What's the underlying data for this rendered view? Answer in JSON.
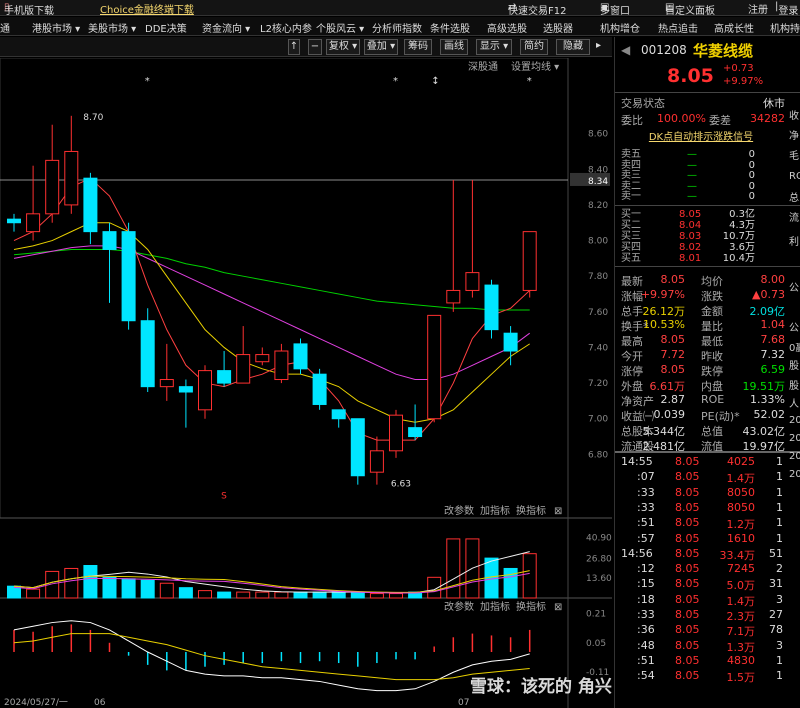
{
  "topbar": {
    "download": "手机版下载",
    "choice": "Choice金融终端下载",
    "quick_trade": "快速交易F12",
    "multi_window": "多窗口",
    "custom_panel": "自定义面板",
    "register": "注册",
    "login": "登录"
  },
  "menubar": {
    "items": [
      "通",
      "港股市场 ▾",
      "美股市场 ▾",
      "DDE决策",
      "资金流向 ▾",
      "L2核心内参",
      "个股风云 ▾",
      "分析师指数",
      "条件选股",
      "高级选股",
      "选股器",
      "机构增仓",
      "热点追击",
      "高成长性",
      "机构持"
    ]
  },
  "toolbar": {
    "items": [
      "↑",
      "−",
      "复权 ▾",
      "叠加 ▾",
      "筹码",
      "画线",
      "显示 ▾",
      "简约",
      "隐藏"
    ]
  },
  "chart": {
    "top_labels": [
      "深股通",
      "设置均线 ▾"
    ],
    "mid_labels": [
      "改参数",
      "加指标",
      "换指标"
    ],
    "bot_labels": [
      "改参数",
      "加指标",
      "换指标"
    ],
    "x_labels": [
      "2024/05/27/一",
      "06",
      "07"
    ],
    "high_label": "8.70",
    "low_label": "6.63",
    "price_line_label": "8.34",
    "vol_axis": [
      "40.90",
      "26.80",
      "13.60"
    ],
    "macd_axis": [
      "0.21",
      "0.05",
      "-0.11"
    ],
    "watermark": "雪球：该死的 角兴系-游资"
  },
  "chart_data": {
    "type": "candlestick",
    "price_ylim": [
      6.6,
      8.8
    ],
    "price_ticks": [
      "8.60",
      "8.40",
      "8.20",
      "8.00",
      "7.80",
      "7.60",
      "7.40",
      "7.20",
      "7.00",
      "6.80"
    ],
    "candles": [
      {
        "o": 8.12,
        "c": 8.1,
        "h": 8.15,
        "l": 8.05,
        "up": false
      },
      {
        "o": 8.05,
        "c": 8.15,
        "h": 8.42,
        "l": 8.0,
        "up": true
      },
      {
        "o": 8.15,
        "c": 8.45,
        "h": 8.65,
        "l": 8.1,
        "up": true
      },
      {
        "o": 8.2,
        "c": 8.5,
        "h": 8.7,
        "l": 8.15,
        "up": true
      },
      {
        "o": 8.35,
        "c": 8.05,
        "h": 8.38,
        "l": 7.98,
        "up": false
      },
      {
        "o": 8.05,
        "c": 7.95,
        "h": 8.1,
        "l": 7.65,
        "up": false
      },
      {
        "o": 8.05,
        "c": 7.55,
        "h": 8.1,
        "l": 7.5,
        "up": false
      },
      {
        "o": 7.55,
        "c": 7.18,
        "h": 7.62,
        "l": 7.15,
        "up": false
      },
      {
        "o": 7.18,
        "c": 7.22,
        "h": 7.42,
        "l": 7.1,
        "up": true
      },
      {
        "o": 7.18,
        "c": 7.15,
        "h": 7.22,
        "l": 6.95,
        "up": false
      },
      {
        "o": 7.05,
        "c": 7.27,
        "h": 7.3,
        "l": 7.0,
        "up": true
      },
      {
        "o": 7.27,
        "c": 7.2,
        "h": 7.38,
        "l": 7.18,
        "up": false
      },
      {
        "o": 7.2,
        "c": 7.36,
        "h": 7.52,
        "l": 7.2,
        "up": true
      },
      {
        "o": 7.32,
        "c": 7.36,
        "h": 7.4,
        "l": 7.3,
        "up": true
      },
      {
        "o": 7.22,
        "c": 7.38,
        "h": 7.42,
        "l": 7.2,
        "up": true
      },
      {
        "o": 7.42,
        "c": 7.28,
        "h": 7.45,
        "l": 7.25,
        "up": false
      },
      {
        "o": 7.25,
        "c": 7.08,
        "h": 7.28,
        "l": 7.05,
        "up": false
      },
      {
        "o": 7.05,
        "c": 7.0,
        "h": 7.05,
        "l": 6.95,
        "up": false
      },
      {
        "o": 7.0,
        "c": 6.68,
        "h": 7.0,
        "l": 6.63,
        "up": false
      },
      {
        "o": 6.7,
        "c": 6.82,
        "h": 6.9,
        "l": 6.63,
        "up": true
      },
      {
        "o": 6.82,
        "c": 7.02,
        "h": 7.05,
        "l": 6.78,
        "up": true
      },
      {
        "o": 6.95,
        "c": 6.9,
        "h": 7.08,
        "l": 6.88,
        "up": false
      },
      {
        "o": 7.0,
        "c": 7.58,
        "h": 7.58,
        "l": 6.98,
        "up": true
      },
      {
        "o": 7.65,
        "c": 7.72,
        "h": 8.34,
        "l": 7.6,
        "up": true
      },
      {
        "o": 7.72,
        "c": 7.82,
        "h": 8.34,
        "l": 7.68,
        "up": true
      },
      {
        "o": 7.75,
        "c": 7.5,
        "h": 7.78,
        "l": 7.45,
        "up": false
      },
      {
        "o": 7.38,
        "c": 7.48,
        "h": 7.52,
        "l": 7.3,
        "up": false
      },
      {
        "o": 7.72,
        "c": 8.05,
        "h": 8.05,
        "l": 7.68,
        "up": true
      }
    ],
    "ma5": [
      8.0,
      8.05,
      8.15,
      8.3,
      8.35,
      8.25,
      8.05,
      7.75,
      7.5,
      7.3,
      7.2,
      7.18,
      7.22,
      7.25,
      7.3,
      7.32,
      7.22,
      7.1,
      6.92,
      6.88,
      6.88,
      6.88,
      7.0,
      7.2,
      7.45,
      7.58,
      7.62,
      7.72
    ],
    "ma10": [
      7.95,
      7.97,
      8.0,
      8.05,
      8.1,
      8.1,
      8.05,
      7.95,
      7.8,
      7.65,
      7.5,
      7.4,
      7.32,
      7.28,
      7.25,
      7.25,
      7.22,
      7.18,
      7.1,
      7.05,
      7.0,
      6.98,
      7.0,
      7.05,
      7.15,
      7.25,
      7.35,
      7.42
    ],
    "ma20": [
      7.9,
      7.92,
      7.94,
      7.96,
      7.97,
      7.97,
      7.95,
      7.9,
      7.85,
      7.8,
      7.75,
      7.7,
      7.65,
      7.6,
      7.55,
      7.5,
      7.45,
      7.4,
      7.35,
      7.3,
      7.25,
      7.22,
      7.22,
      7.25,
      7.3,
      7.35,
      7.4,
      7.48
    ],
    "ma30": [
      7.92,
      7.93,
      7.94,
      7.95,
      7.95,
      7.95,
      7.94,
      7.92,
      7.9,
      7.87,
      7.85,
      7.82,
      7.8,
      7.78,
      7.76,
      7.74,
      7.72,
      7.7,
      7.68,
      7.66,
      7.65,
      7.64,
      7.63,
      7.62,
      7.62,
      7.61,
      7.61,
      7.61
    ],
    "volume": [
      8,
      6,
      18,
      20,
      22,
      14,
      13,
      12,
      10,
      7,
      5,
      4,
      4,
      4,
      4,
      4,
      4,
      4,
      4,
      3,
      3,
      4,
      14,
      40,
      40,
      27,
      20,
      30
    ],
    "vol_ylim": [
      0,
      44
    ],
    "macd": [
      0.12,
      0.11,
      0.14,
      0.15,
      0.12,
      0.05,
      -0.02,
      -0.07,
      -0.1,
      -0.1,
      -0.08,
      -0.07,
      -0.06,
      -0.06,
      -0.05,
      -0.06,
      -0.05,
      -0.06,
      -0.08,
      -0.06,
      -0.04,
      -0.04,
      0.03,
      0.08,
      0.1,
      0.09,
      0.08,
      0.12
    ],
    "dif": [
      0.12,
      0.14,
      0.16,
      0.17,
      0.16,
      0.12,
      0.06,
      0.0,
      -0.05,
      -0.1,
      -0.12,
      -0.13,
      -0.13,
      -0.14,
      -0.14,
      -0.15,
      -0.16,
      -0.18,
      -0.2,
      -0.21,
      -0.21,
      -0.2,
      -0.16,
      -0.11,
      -0.07,
      -0.05,
      -0.04,
      -0.01
    ],
    "dea": [
      0.05,
      0.06,
      0.08,
      0.1,
      0.1,
      0.1,
      0.08,
      0.06,
      0.04,
      0.01,
      -0.02,
      -0.04,
      -0.06,
      -0.08,
      -0.09,
      -0.1,
      -0.11,
      -0.12,
      -0.13,
      -0.14,
      -0.15,
      -0.15,
      -0.15,
      -0.14,
      -0.12,
      -0.11,
      -0.1,
      -0.09
    ],
    "macd_ylim": [
      -0.25,
      0.25
    ]
  },
  "panel": {
    "code": "001208",
    "name": "华菱线缆",
    "price": "8.05",
    "change": "+0.73",
    "change_pct": "+9.97%",
    "status_label": "交易状态",
    "status": "休市",
    "wb_label": "委比",
    "wb": "100.00%",
    "wc_label": "委差",
    "wc": "34282",
    "dk_signal": "DK点自动排示涨跌信号",
    "asks": [
      {
        "l": "卖五",
        "p": "—",
        "v": "0"
      },
      {
        "l": "卖四",
        "p": "—",
        "v": "0"
      },
      {
        "l": "卖三",
        "p": "—",
        "v": "0"
      },
      {
        "l": "卖二",
        "p": "—",
        "v": "0"
      },
      {
        "l": "卖一",
        "p": "—",
        "v": "0"
      }
    ],
    "bids": [
      {
        "l": "买一",
        "p": "8.05",
        "v": "0.3亿"
      },
      {
        "l": "买二",
        "p": "8.04",
        "v": "4.3万"
      },
      {
        "l": "买三",
        "p": "8.03",
        "v": "10.7万"
      },
      {
        "l": "买四",
        "p": "8.02",
        "v": "3.6万"
      },
      {
        "l": "买五",
        "p": "8.01",
        "v": "10.4万"
      }
    ],
    "stats": [
      [
        {
          "l": "最新",
          "v": "8.05",
          "c": "red"
        },
        {
          "l": "均价",
          "v": "8.00",
          "c": "red"
        }
      ],
      [
        {
          "l": "涨幅",
          "v": "+9.97%",
          "c": "red"
        },
        {
          "l": "涨跌",
          "v": "▲0.73",
          "c": "red"
        }
      ],
      [
        {
          "l": "总手",
          "v": "26.12万",
          "c": "yellow"
        },
        {
          "l": "金额",
          "v": "2.09亿",
          "c": "cyan"
        }
      ],
      [
        {
          "l": "换手*",
          "v": "10.53%",
          "c": "yellow"
        },
        {
          "l": "量比",
          "v": "1.04",
          "c": "red"
        }
      ],
      [
        {
          "l": "最高",
          "v": "8.05",
          "c": "red"
        },
        {
          "l": "最低",
          "v": "7.68",
          "c": "red"
        }
      ],
      [
        {
          "l": "今开",
          "v": "7.72",
          "c": "red"
        },
        {
          "l": "昨收",
          "v": "7.32",
          "c": "white"
        }
      ],
      [
        {
          "l": "涨停",
          "v": "8.05",
          "c": "red"
        },
        {
          "l": "跌停",
          "v": "6.59",
          "c": "green"
        }
      ],
      [
        {
          "l": "外盘",
          "v": "6.61万",
          "c": "red"
        },
        {
          "l": "内盘",
          "v": "19.51万",
          "c": "green"
        }
      ],
      [
        {
          "l": "净资产",
          "v": "2.87",
          "c": "white"
        },
        {
          "l": "ROE",
          "v": "1.33%",
          "c": "white"
        }
      ],
      [
        {
          "l": "收益㈠",
          "v": "0.039",
          "c": "white"
        },
        {
          "l": "PE(动)*",
          "v": "52.02",
          "c": "white"
        }
      ],
      [
        {
          "l": "总股本",
          "v": "5.344亿",
          "c": "white"
        },
        {
          "l": "总值",
          "v": "43.02亿",
          "c": "white"
        }
      ],
      [
        {
          "l": "流通股",
          "v": "2.481亿",
          "c": "white"
        },
        {
          "l": "流值",
          "v": "19.97亿",
          "c": "white"
        }
      ]
    ],
    "ticks": [
      {
        "t": "14:55",
        "p": "8.05",
        "v": "4025",
        "n": "1"
      },
      {
        "t": ":07",
        "p": "8.05",
        "v": "1.4万",
        "n": "1"
      },
      {
        "t": ":33",
        "p": "8.05",
        "v": "8050",
        "n": "1"
      },
      {
        "t": ":33",
        "p": "8.05",
        "v": "8050",
        "n": "1"
      },
      {
        "t": ":51",
        "p": "8.05",
        "v": "1.2万",
        "n": "1"
      },
      {
        "t": ":57",
        "p": "8.05",
        "v": "1610",
        "n": "1"
      },
      {
        "t": "14:56",
        "p": "8.05",
        "v": "33.4万",
        "n": "51"
      },
      {
        "t": ":12",
        "p": "8.05",
        "v": "7245",
        "n": "2"
      },
      {
        "t": ":15",
        "p": "8.05",
        "v": "5.0万",
        "n": "31"
      },
      {
        "t": ":18",
        "p": "8.05",
        "v": "1.4万",
        "n": "3"
      },
      {
        "t": ":33",
        "p": "8.05",
        "v": "2.3万",
        "n": "27"
      },
      {
        "t": ":36",
        "p": "8.05",
        "v": "7.1万",
        "n": "78"
      },
      {
        "t": ":48",
        "p": "8.05",
        "v": "1.3万",
        "n": "3"
      },
      {
        "t": ":51",
        "p": "8.05",
        "v": "4830",
        "n": "1"
      },
      {
        "t": ":54",
        "p": "8.05",
        "v": "1.5万",
        "n": "1"
      }
    ],
    "edge": [
      "收",
      "净",
      "毛",
      "ROE",
      "总",
      "流",
      "利",
      "公",
      "公",
      "0赢",
      "股",
      "股",
      "人",
      "20",
      "20",
      "20",
      "20"
    ]
  },
  "colors": {
    "up": "#ff3030",
    "down": "#00e5ff",
    "ma5": "#ffffff",
    "ma10": "#e8d000",
    "ma20": "#e040e0",
    "ma30": "#00d000"
  }
}
